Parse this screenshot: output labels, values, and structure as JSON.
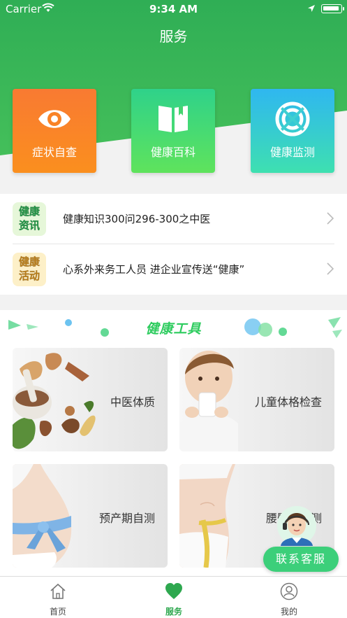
{
  "status_bar": {
    "carrier": "Carrier",
    "time": "9:34 AM"
  },
  "header": {
    "title": "服务"
  },
  "tiles": [
    {
      "label": "症状自查",
      "icon": "eye-icon"
    },
    {
      "label": "健康百科",
      "icon": "book-icon"
    },
    {
      "label": "健康监测",
      "icon": "monitor-icon"
    }
  ],
  "news": [
    {
      "badge": [
        "健康",
        "资讯"
      ],
      "badge_color": "#2bc25a",
      "text": "健康知识300问296-300之中医"
    },
    {
      "badge": [
        "健康",
        "活动"
      ],
      "badge_color": "#f5a623",
      "text": "心系外来务工人员 进企业宣传送“健康”"
    }
  ],
  "tools": {
    "title": "健康工具",
    "cards": [
      {
        "label": "中医体质"
      },
      {
        "label": "儿童体格检查"
      },
      {
        "label": "预产期自测"
      },
      {
        "label": "腰臀比自测"
      }
    ]
  },
  "service_button": {
    "label": "联系客服"
  },
  "tabbar": {
    "items": [
      {
        "label": "首页",
        "icon": "home-icon"
      },
      {
        "label": "服务",
        "icon": "heart-icon",
        "active": true
      },
      {
        "label": "我的",
        "icon": "user-icon"
      }
    ]
  },
  "colors": {
    "primary": "#2ea84f",
    "header_green": "#32b356"
  }
}
